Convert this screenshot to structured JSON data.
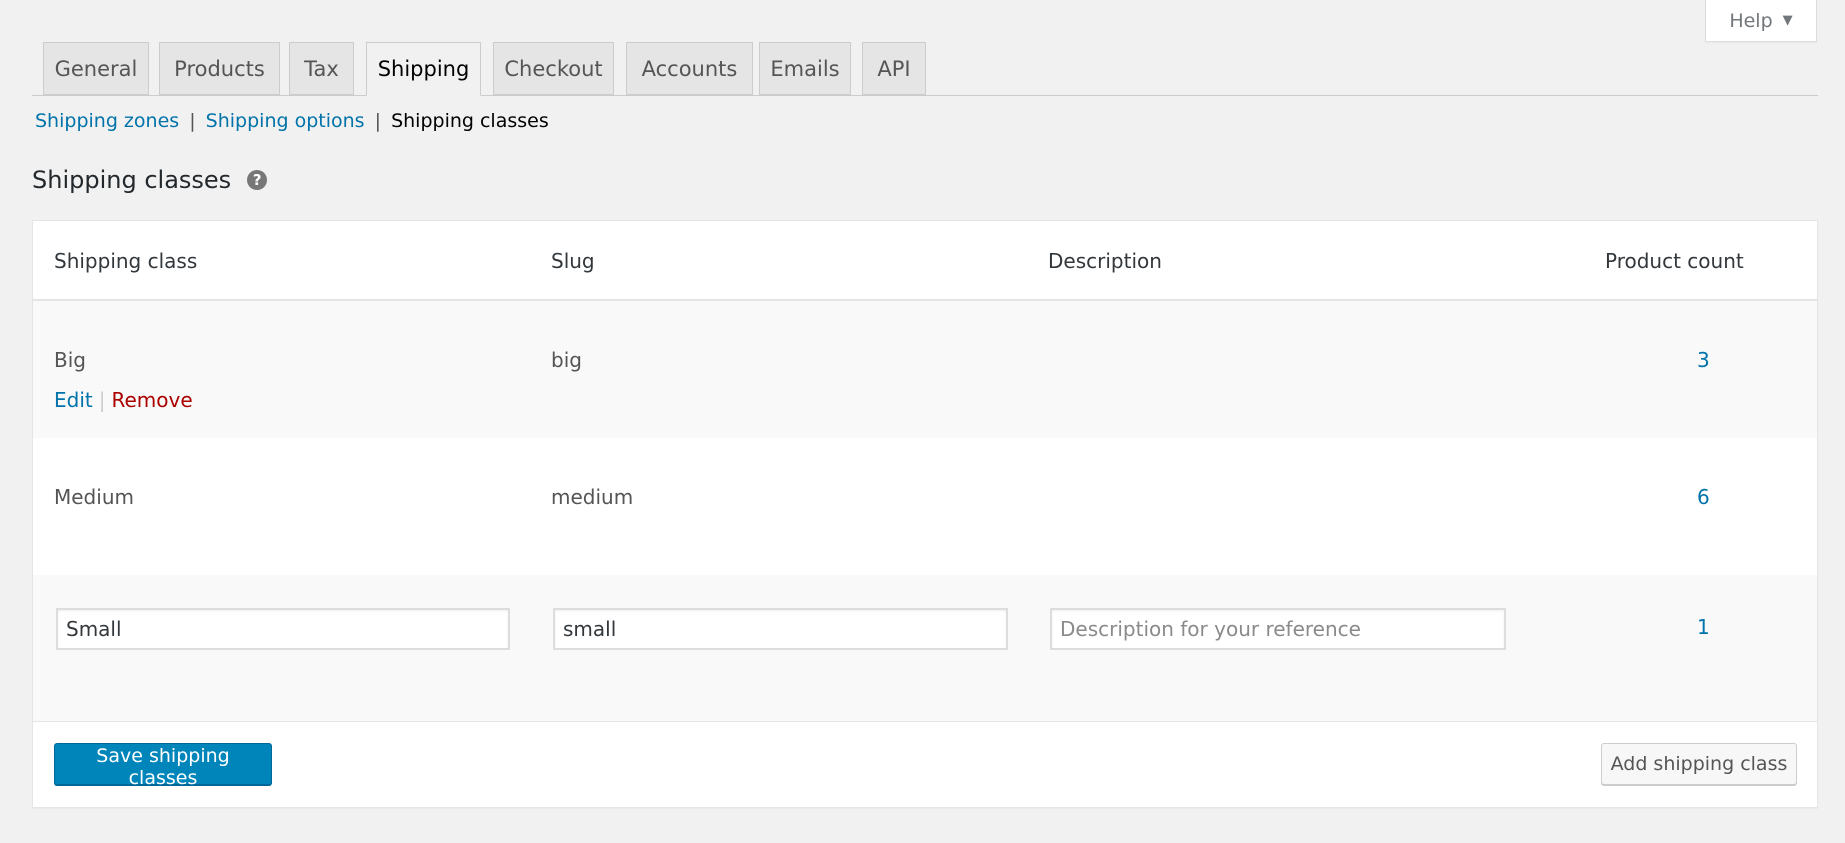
{
  "help": {
    "label": "Help",
    "arrow": "▼"
  },
  "tabs": [
    {
      "label": "General",
      "active": false
    },
    {
      "label": "Products",
      "active": false
    },
    {
      "label": "Tax",
      "active": false
    },
    {
      "label": "Shipping",
      "active": true
    },
    {
      "label": "Checkout",
      "active": false
    },
    {
      "label": "Accounts",
      "active": false
    },
    {
      "label": "Emails",
      "active": false
    },
    {
      "label": "API",
      "active": false
    }
  ],
  "subnav": {
    "zones": "Shipping zones",
    "options": "Shipping options",
    "classes": "Shipping classes",
    "separator": "|"
  },
  "heading": {
    "title": "Shipping classes",
    "help_icon": "?"
  },
  "table": {
    "columns": {
      "class": "Shipping class",
      "slug": "Slug",
      "description": "Description",
      "count": "Product count"
    },
    "rows": [
      {
        "name": "Big",
        "slug": "big",
        "description": "",
        "count": "3"
      },
      {
        "name": "Medium",
        "slug": "medium",
        "description": "",
        "count": "6"
      }
    ],
    "row_actions": {
      "edit": "Edit",
      "separator": "|",
      "remove": "Remove"
    },
    "editing_row": {
      "name_value": "Small",
      "slug_value": "small",
      "description_value": "",
      "description_placeholder": "Description for your reference",
      "count": "1"
    }
  },
  "footer": {
    "save_label": "Save shipping classes",
    "add_label": "Add shipping class"
  },
  "colors": {
    "link": "#0073aa",
    "remove": "#aa0000",
    "primary_button": "#0085ba"
  }
}
